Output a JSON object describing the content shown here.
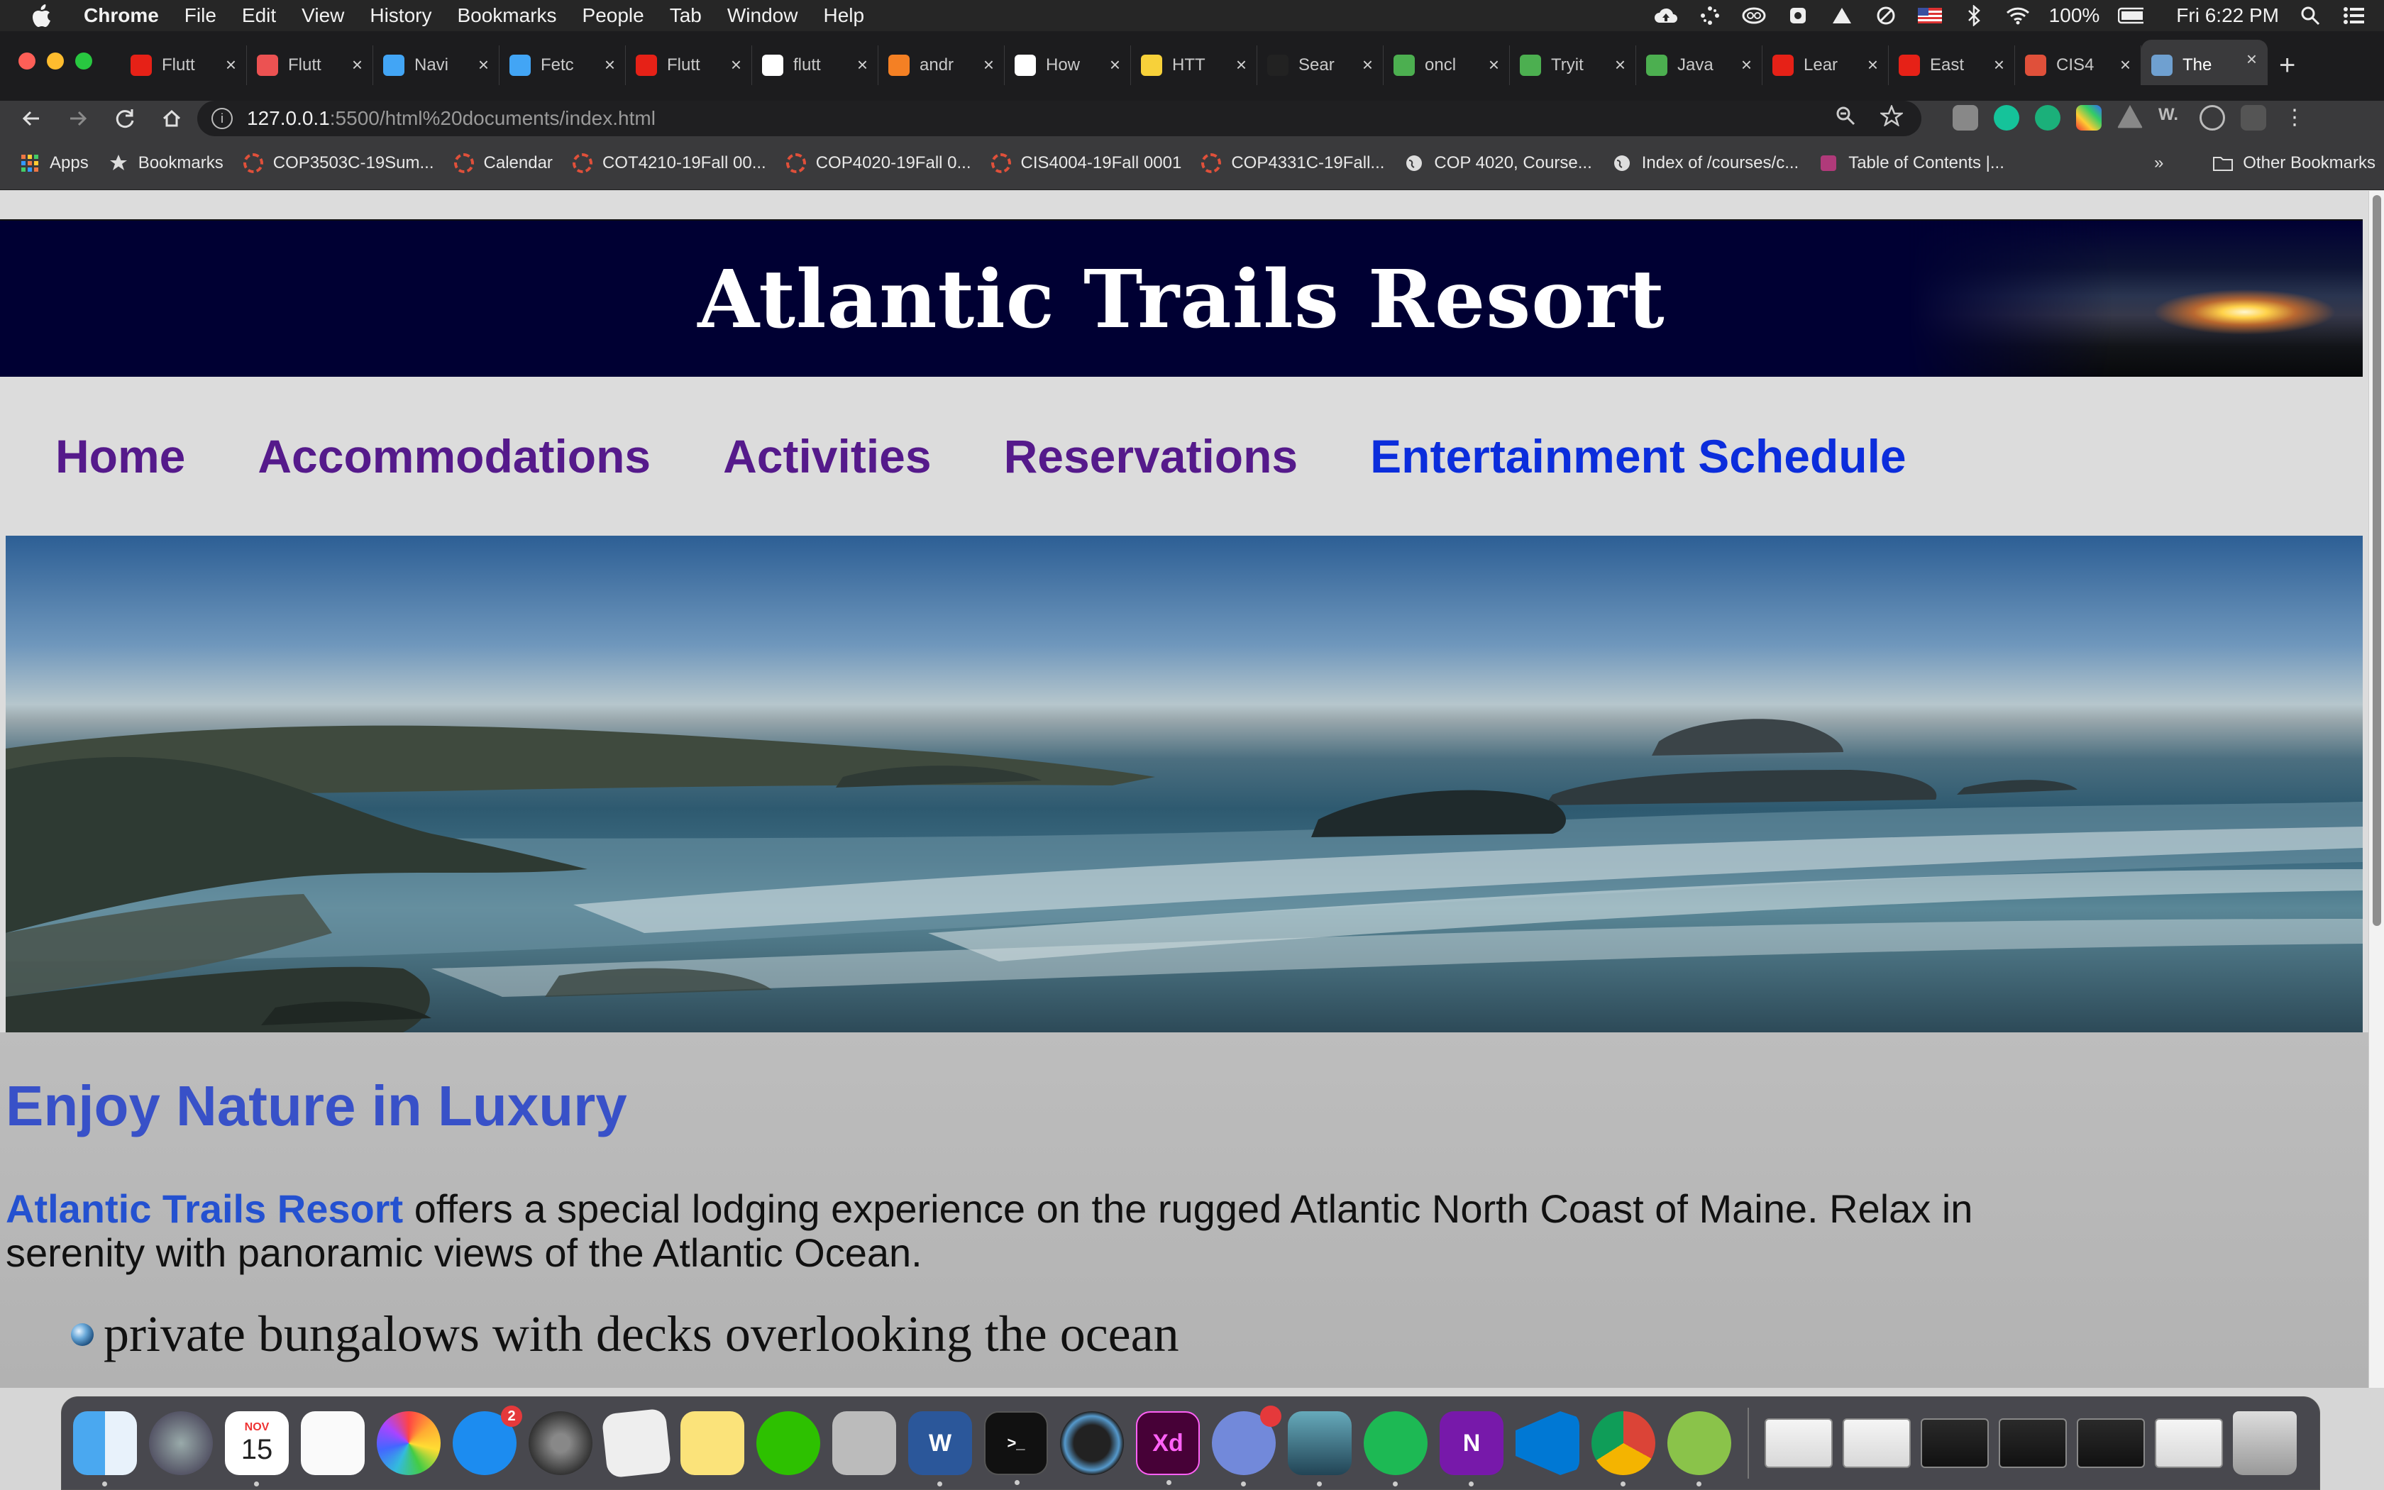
{
  "menubar": {
    "items": [
      "Chrome",
      "File",
      "Edit",
      "View",
      "History",
      "Bookmarks",
      "People",
      "Tab",
      "Window",
      "Help"
    ],
    "battery": "100%",
    "clock": "Fri 6:22 PM"
  },
  "tabs": [
    {
      "label": "Flutt",
      "favicon": "youtube-icon",
      "color": "#e62117"
    },
    {
      "label": "Flutt",
      "favicon": "udemy-icon",
      "color": "#ec5252"
    },
    {
      "label": "Navi",
      "favicon": "flutter-icon",
      "color": "#42a5f5"
    },
    {
      "label": "Fetc",
      "favicon": "flutter-icon",
      "color": "#42a5f5"
    },
    {
      "label": "Flutt",
      "favicon": "youtube-icon",
      "color": "#e62117"
    },
    {
      "label": "flutt",
      "favicon": "google-icon",
      "color": "#ffffff"
    },
    {
      "label": "andr",
      "favicon": "stackoverflow-icon",
      "color": "#f48024"
    },
    {
      "label": "How",
      "favicon": "medium-icon",
      "color": "#ffffff"
    },
    {
      "label": "HTT",
      "favicon": "python-icon",
      "color": "#f7d13a"
    },
    {
      "label": "Sear",
      "favicon": "github-icon",
      "color": "#222222"
    },
    {
      "label": "oncl",
      "favicon": "w3schools-icon",
      "color": "#4caf50"
    },
    {
      "label": "Tryit",
      "favicon": "w3schools-icon",
      "color": "#4caf50"
    },
    {
      "label": "Java",
      "favicon": "w3schools-icon",
      "color": "#4caf50"
    },
    {
      "label": "Lear",
      "favicon": "youtube-icon",
      "color": "#e62117"
    },
    {
      "label": "East",
      "favicon": "youtube-icon",
      "color": "#e62117"
    },
    {
      "label": "CIS4",
      "favicon": "canvas-icon",
      "color": "#e0503a"
    },
    {
      "label": "The",
      "favicon": "page-icon",
      "color": "#6fa0d0",
      "active": true
    }
  ],
  "toolbar": {
    "url_host": "127.0.0.1",
    "url_path": ":5500/html%20documents/index.html"
  },
  "bookmarks": {
    "items": [
      {
        "label": "Apps",
        "icon": "apps-grid-icon"
      },
      {
        "label": "Bookmarks",
        "icon": "star-icon"
      },
      {
        "label": "COP3503C-19Sum...",
        "icon": "canvas-icon"
      },
      {
        "label": "Calendar",
        "icon": "canvas-icon"
      },
      {
        "label": "COT4210-19Fall 00...",
        "icon": "canvas-icon"
      },
      {
        "label": "COP4020-19Fall 0...",
        "icon": "canvas-icon"
      },
      {
        "label": "CIS4004-19Fall 0001",
        "icon": "canvas-icon"
      },
      {
        "label": "COP4331C-19Fall...",
        "icon": "canvas-icon"
      },
      {
        "label": "COP 4020, Course...",
        "icon": "globe-icon"
      },
      {
        "label": "Index of /courses/c...",
        "icon": "globe-icon"
      },
      {
        "label": "Table of Contents |...",
        "icon": "book-icon"
      }
    ],
    "more": "»",
    "other": "Other Bookmarks"
  },
  "site": {
    "title": "Atlantic Trails Resort",
    "nav": [
      "Home",
      "Accommodations",
      "Activities",
      "Reservations",
      "Entertainment Schedule"
    ],
    "heading": "Enjoy Nature in Luxury",
    "intro_brand": "Atlantic Trails Resort",
    "intro_rest": " offers a special lodging experience on the rugged Atlantic North Coast of Maine. Relax in serenity with panoramic views of the Atlantic Ocean.",
    "list": [
      "private bungalows with decks overlooking the ocean"
    ]
  },
  "dock": {
    "calendar_month": "NOV",
    "calendar_day": "15",
    "appstore_badge": "2"
  }
}
